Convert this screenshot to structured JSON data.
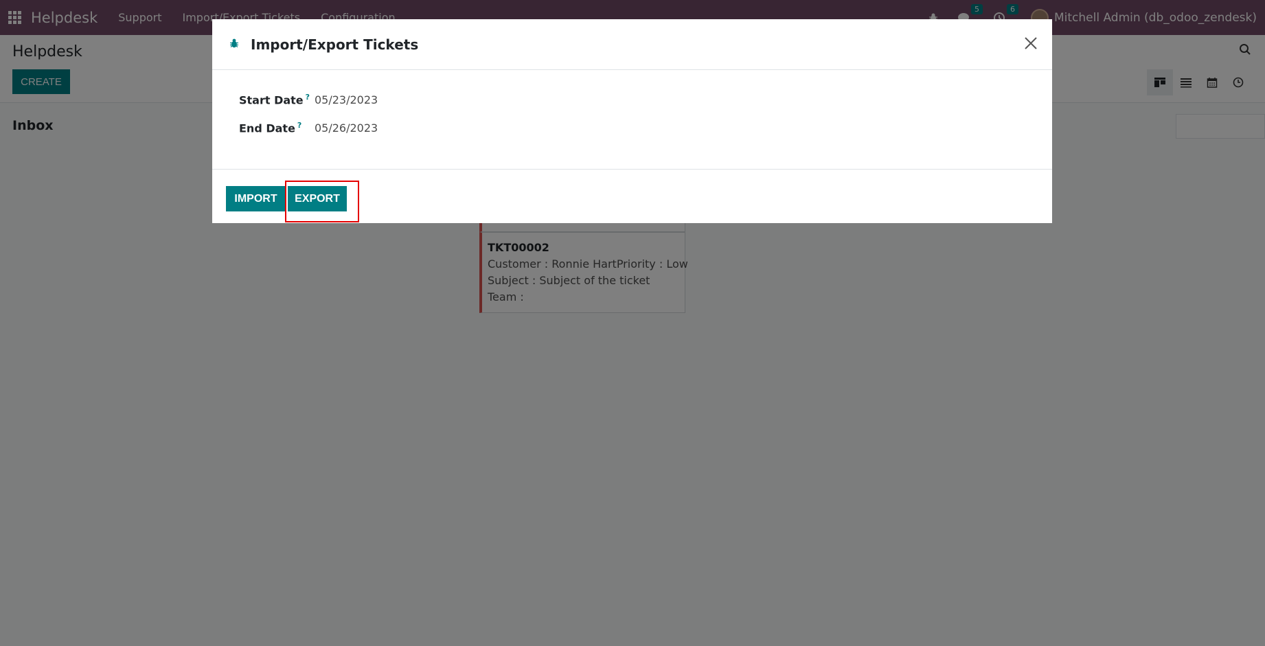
{
  "navbar": {
    "brand": "Helpdesk",
    "menus": [
      "Support",
      "Import/Export Tickets",
      "Configuration"
    ],
    "messages_count": "5",
    "activities_count": "6",
    "user": "Mitchell Admin (db_odoo_zendesk)"
  },
  "control_panel": {
    "breadcrumb": "Helpdesk",
    "create_label": "CREATE",
    "views": [
      "kanban-icon",
      "list-icon",
      "calendar-icon",
      "activity-icon"
    ]
  },
  "kanban": {
    "column_title": "Inbox",
    "card": {
      "reference": "TKT00002",
      "customer_label": "Customer : Ronnie Hart",
      "priority_label": "Priority : Low",
      "subject_label": "Subject : Subject of the ticket",
      "team_label": "Team :"
    }
  },
  "modal": {
    "title": "Import/Export Tickets",
    "start_date_label": "Start Date",
    "start_date_value": "05/23/2023",
    "end_date_label": "End Date",
    "end_date_value": "05/26/2023",
    "help_marker": "?",
    "import_label": "IMPORT",
    "export_label": "EXPORT"
  },
  "colors": {
    "navbar": "#714b67",
    "primary": "#017e84",
    "highlight": "#e50000"
  }
}
